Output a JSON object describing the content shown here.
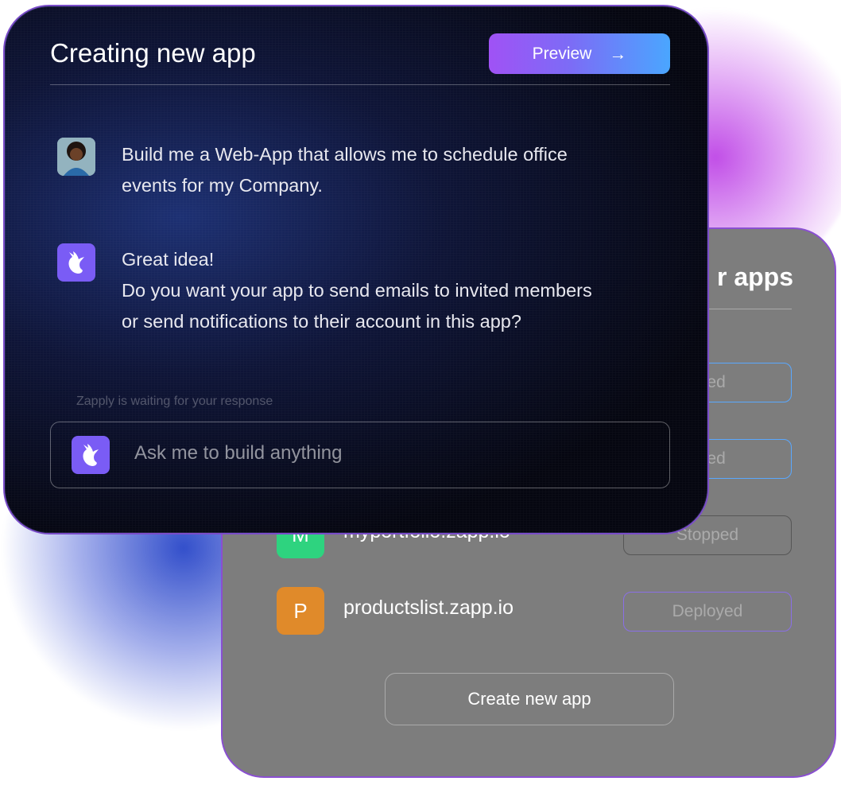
{
  "chat": {
    "title": "Creating new app",
    "preview_label": "Preview",
    "messages": [
      {
        "sender": "user",
        "text_line1": "Build me a Web-App that allows me to schedule office",
        "text_line2": "events for my Company."
      },
      {
        "sender": "bot",
        "text_line1": "Great idea!",
        "text_line2": "Do you want your app to send emails to invited members",
        "text_line3": "or send notifications to their account in this app?"
      }
    ],
    "waiting_text": "Zapply is waiting for your response",
    "input_placeholder": "Ask me to build anything"
  },
  "apps": {
    "title_visible": "r apps",
    "items": [
      {
        "avatar_letter": "",
        "name": "",
        "status": "oyed",
        "avatar_color": "#7d7d7d"
      },
      {
        "avatar_letter": "",
        "name": "",
        "status": "oyed",
        "avatar_color": "#7d7d7d"
      },
      {
        "avatar_letter": "M",
        "name": "myportfolio.zapp.io",
        "status": "Stopped",
        "avatar_color": "#2ed37f"
      },
      {
        "avatar_letter": "P",
        "name": "productslist.zapp.io",
        "status": "Deployed",
        "avatar_color": "#e08a2a"
      }
    ],
    "create_label": "Create new app"
  },
  "colors": {
    "accent_purple": "#7a5cf5",
    "deployed_border": "#5aa8ff",
    "card_border": "#8a4fd1"
  }
}
